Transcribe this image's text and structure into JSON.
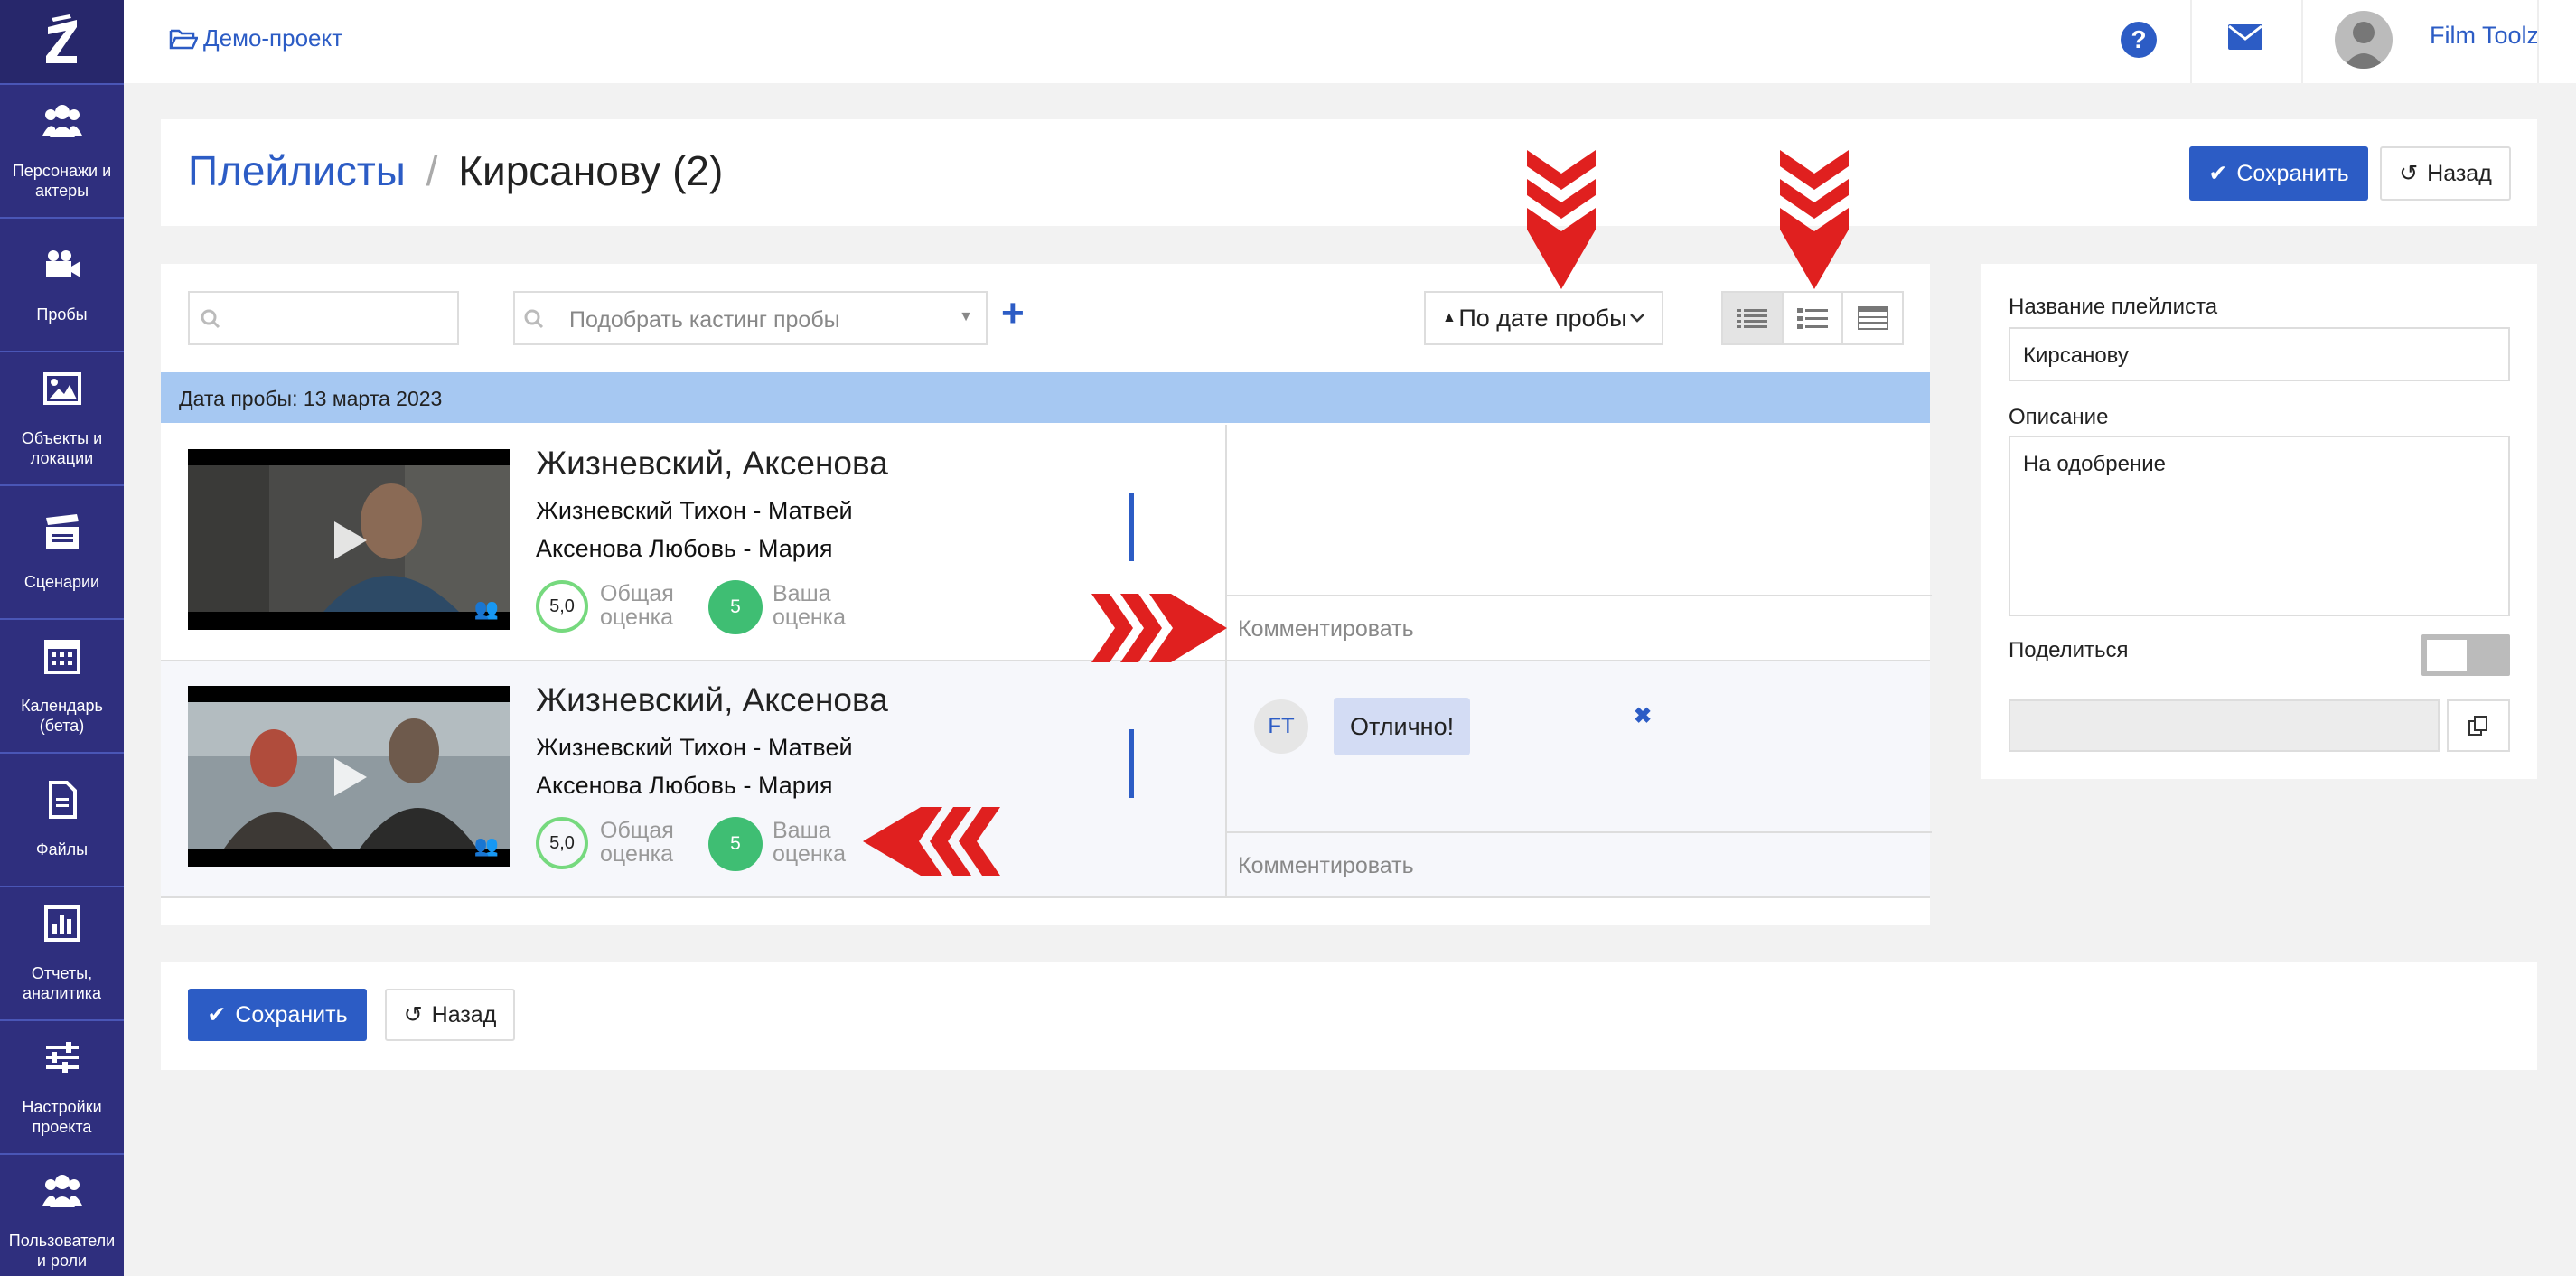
{
  "sidebar": {
    "logo": "Z",
    "items": [
      {
        "label": "Персонажи и актеры",
        "icon": "users-icon"
      },
      {
        "label": "Пробы",
        "icon": "video-camera-icon"
      },
      {
        "label": "Объекты и локации",
        "icon": "image-icon"
      },
      {
        "label": "Сценарии",
        "icon": "clapperboard-icon"
      },
      {
        "label": "Календарь (бета)",
        "icon": "calendar-icon"
      },
      {
        "label": "Файлы",
        "icon": "file-icon"
      },
      {
        "label": "Отчеты, аналитика",
        "icon": "bar-chart-icon"
      },
      {
        "label": "Настройки проекта",
        "icon": "sliders-icon"
      },
      {
        "label": "Пользователи и роли",
        "icon": "users-icon"
      }
    ]
  },
  "topbar": {
    "project": "Демо-проект",
    "user": "Film Toolz"
  },
  "header": {
    "crumb": "Плейлисты",
    "separator": "/",
    "title": "Кирсанову",
    "count": "(2)",
    "save_label": "Сохранить",
    "back_label": "Назад"
  },
  "toolbar": {
    "search_placeholder": "",
    "casting_placeholder": "Подобрать кастинг пробы",
    "add": "+",
    "sort_label": "По дате пробы"
  },
  "date_group": "Дата пробы: 13 марта 2023",
  "rows": [
    {
      "title": "Жизневский, Аксенова",
      "role1": "Жизневский Тихон - Матвей",
      "role2": "Аксенова Любовь - Мария",
      "overall_score": "5,0",
      "overall_label1": "Общая",
      "overall_label2": "оценка",
      "my_score": "5",
      "my_label1": "Ваша",
      "my_label2": "оценка",
      "comment_placeholder": "Комментировать"
    },
    {
      "title": "Жизневский, Аксенова",
      "role1": "Жизневский Тихон - Матвей",
      "role2": "Аксенова Любовь - Мария",
      "overall_score": "5,0",
      "overall_label1": "Общая",
      "overall_label2": "оценка",
      "my_score": "5",
      "my_label1": "Ваша",
      "my_label2": "оценка",
      "comment_author": "FT",
      "comment_text": "Отлично!",
      "comment_delete": "✖",
      "comment_placeholder": "Комментировать"
    }
  ],
  "side": {
    "name_label": "Название плейлиста",
    "name_value": "Кирсанову",
    "desc_label": "Описание",
    "desc_value": "На одобрение",
    "share_label": "Поделиться"
  },
  "bottom": {
    "save_label": "Сохранить",
    "back_label": "Назад"
  },
  "colors": {
    "sidebar": "#2f2f7e",
    "accent": "#2c5cc5",
    "date_bar": "#a6c8f2",
    "score_green": "#3fbe73",
    "annotation_red": "#e0201f"
  }
}
